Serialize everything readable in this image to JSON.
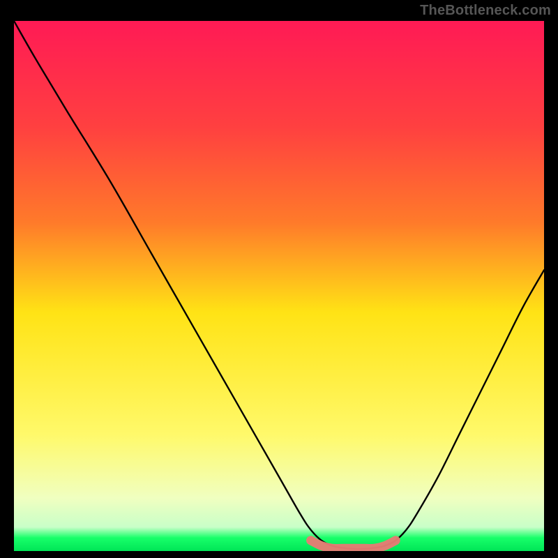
{
  "watermark": "TheBottleneck.com",
  "chart_data": {
    "type": "line",
    "title": "",
    "xlabel": "",
    "ylabel": "",
    "xlim": [
      0,
      100
    ],
    "ylim": [
      0,
      100
    ],
    "grid": false,
    "legend": false,
    "series": [
      {
        "name": "curve-left",
        "x": [
          0,
          4,
          10,
          18,
          26,
          34,
          42,
          50,
          54,
          56,
          58,
          60
        ],
        "y": [
          100,
          93,
          83,
          70,
          56,
          42,
          28,
          14,
          7,
          4,
          2,
          1
        ]
      },
      {
        "name": "curve-right",
        "x": [
          70,
          72,
          74,
          76,
          80,
          84,
          88,
          92,
          96,
          100
        ],
        "y": [
          1,
          2,
          4,
          7,
          14,
          22,
          30,
          38,
          46,
          53
        ]
      },
      {
        "name": "marker-band",
        "x": [
          56,
          58,
          60,
          62,
          64,
          66,
          68,
          70,
          72
        ],
        "y": [
          2,
          1,
          0.5,
          0.5,
          0.5,
          0.5,
          0.5,
          1,
          2
        ]
      }
    ],
    "background_gradient": {
      "top": "#ff1a55",
      "mid_upper": "#ff7a2a",
      "mid": "#ffe315",
      "mid_lower": "#fff96a",
      "low": "#f0ffc0",
      "bottom": "#18ff6a"
    },
    "marker_color": "#e77b74"
  }
}
